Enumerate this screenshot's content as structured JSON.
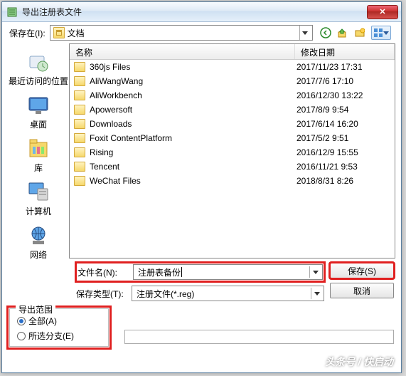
{
  "title": "导出注册表文件",
  "toolbar": {
    "save_in_label": "保存在(I):",
    "location_name": "文档"
  },
  "columns": {
    "name": "名称",
    "date": "修改日期"
  },
  "sidebar": [
    {
      "label": "最近访问的位置"
    },
    {
      "label": "桌面"
    },
    {
      "label": "库"
    },
    {
      "label": "计算机"
    },
    {
      "label": "网络"
    }
  ],
  "files": [
    {
      "name": "360js Files",
      "date": "2017/11/23 17:31"
    },
    {
      "name": "AliWangWang",
      "date": "2017/7/6 17:10"
    },
    {
      "name": "AliWorkbench",
      "date": "2016/12/30 13:22"
    },
    {
      "name": "Apowersoft",
      "date": "2017/8/9 9:54"
    },
    {
      "name": "Downloads",
      "date": "2017/6/14 16:20"
    },
    {
      "name": "Foxit ContentPlatform",
      "date": "2017/5/2 9:51"
    },
    {
      "name": "Rising",
      "date": "2016/12/9 15:55"
    },
    {
      "name": "Tencent",
      "date": "2016/11/21 9:53"
    },
    {
      "name": "WeChat Files",
      "date": "2018/8/31 8:26"
    }
  ],
  "form": {
    "filename_label": "文件名(N):",
    "filename_value": "注册表备份",
    "filetype_label": "保存类型(T):",
    "filetype_value": "注册文件(*.reg)",
    "save_btn": "保存(S)",
    "cancel_btn": "取消"
  },
  "export": {
    "legend": "导出范围",
    "all_label": "全部(A)",
    "branch_label": "所选分支(E)"
  },
  "watermark": "头条号 / 快启动"
}
